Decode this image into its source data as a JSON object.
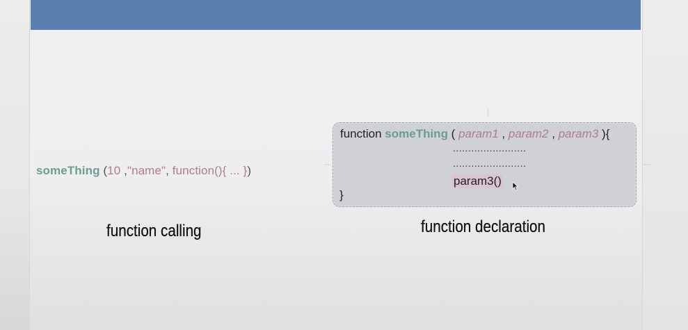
{
  "call": {
    "name": "someThing",
    "open": " (",
    "arg1": "10",
    "sep1": "  ,",
    "arg2": "\"name\"",
    "sep2": ",  ",
    "arg3": "function(){ ... }",
    "close": ")"
  },
  "declaration": {
    "keyword": "function",
    "name": "someThing",
    "open": " ( ",
    "param1": "param1",
    "sep1": " , ",
    "param2": "param2",
    "sep2": " , ",
    "param3": "param3",
    "close": " ){",
    "dots1": "........................",
    "dots2": "........................",
    "body_call": "param3()",
    "end": "}"
  },
  "captions": {
    "calling": "function calling",
    "declaration": "function declaration"
  },
  "colors": {
    "banner": "#5a7fb0",
    "function_name": "#6a9d93",
    "argument": "#b07b8c",
    "highlight": "#d9c4d3",
    "code_box": "#cfd1d5"
  },
  "icons": {
    "pointer": "mouse-cursor-icon"
  }
}
